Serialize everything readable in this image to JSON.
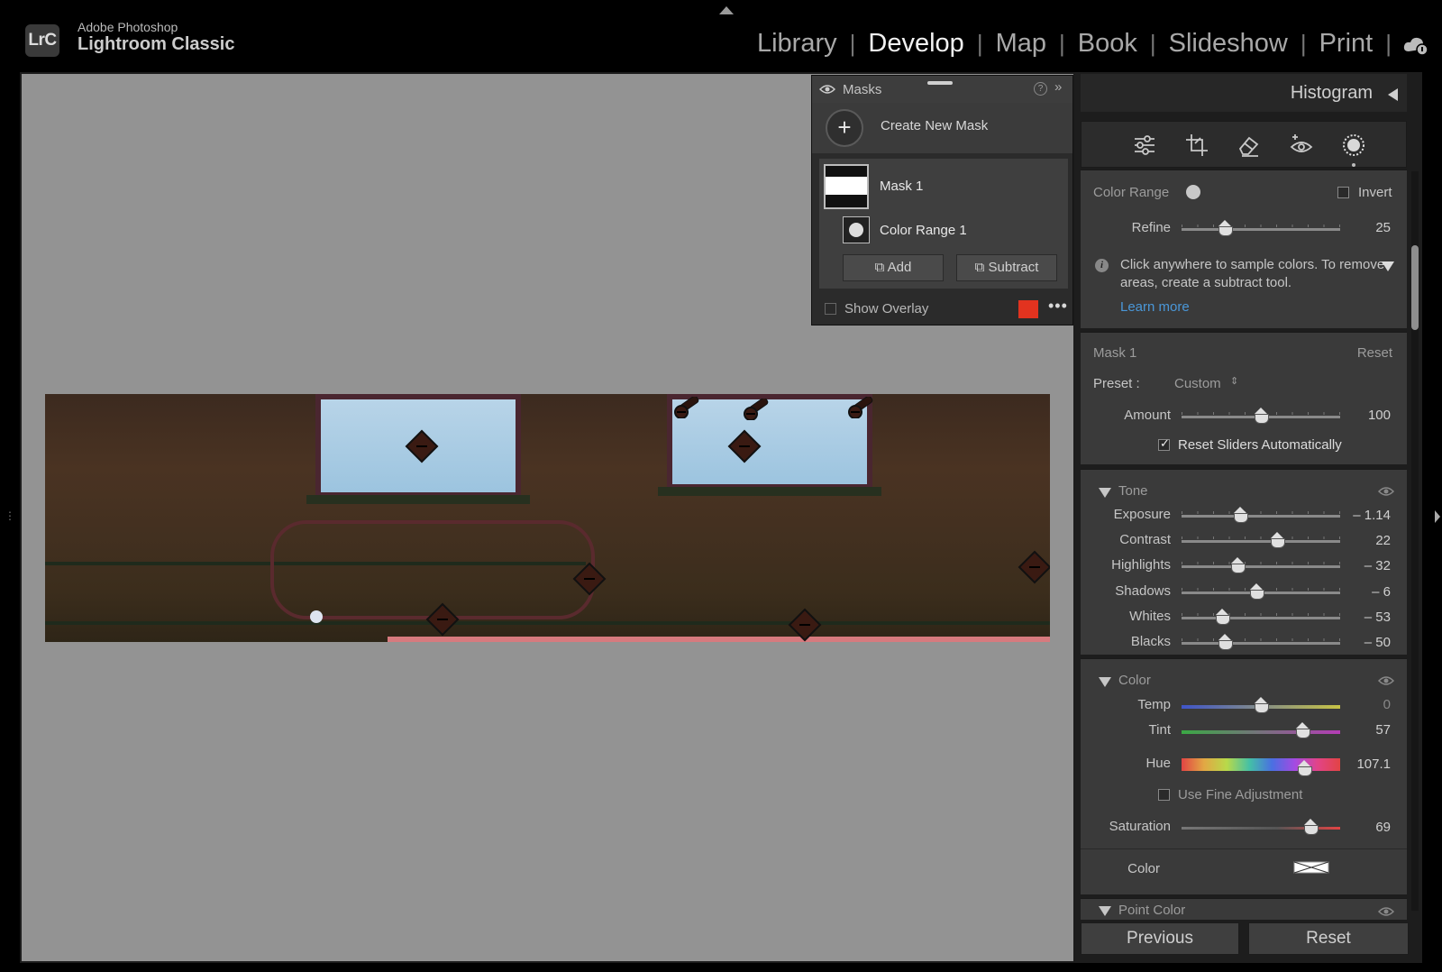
{
  "app": {
    "brand_line1": "Adobe Photoshop",
    "brand_line2": "Lightroom Classic",
    "logo": "LrC",
    "modules": [
      "Library",
      "Develop",
      "Map",
      "Book",
      "Slideshow",
      "Print"
    ],
    "active_module": "Develop",
    "cloud_icon": "cloud-sync-icon"
  },
  "masks_panel": {
    "title": "Masks",
    "help": "?",
    "create_label": "Create New Mask",
    "mask_name": "Mask 1",
    "component_name": "Color Range 1",
    "add_label": "Add",
    "subtract_label": "Subtract",
    "show_overlay_label": "Show Overlay",
    "show_overlay_checked": false,
    "overlay_color": "#e2331f",
    "more": "•••"
  },
  "right_panel": {
    "histogram_label": "Histogram",
    "tools": [
      "edit-sliders-icon",
      "crop-icon",
      "heal-eraser-icon",
      "redeye-icon",
      "masking-icon"
    ],
    "color_range": {
      "label": "Color Range",
      "invert_label": "Invert",
      "invert_checked": false,
      "refine_label": "Refine",
      "refine_value": "25",
      "refine_level": 0.27,
      "info_text_1": "Click anywhere to sample colors. To remove",
      "info_text_2": "areas, create a subtract tool.",
      "learn_more": "Learn more"
    },
    "mask_section": {
      "title": "Mask 1",
      "reset": "Reset",
      "preset_label": "Preset :",
      "preset_value": "Custom",
      "amount_label": "Amount",
      "amount_value": "100",
      "amount_level": 0.5,
      "reset_sliders_label": "Reset Sliders Automatically",
      "reset_sliders_checked": true
    },
    "tone": {
      "title": "Tone",
      "sliders": [
        {
          "label": "Exposure",
          "value": "– 1.14",
          "level": 0.37
        },
        {
          "label": "Contrast",
          "value": "22",
          "level": 0.605
        },
        {
          "label": "Highlights",
          "value": "– 32",
          "level": 0.355
        },
        {
          "label": "Shadows",
          "value": "– 6",
          "level": 0.47
        },
        {
          "label": "Whites",
          "value": "– 53",
          "level": 0.255
        },
        {
          "label": "Blacks",
          "value": "– 50",
          "level": 0.27
        }
      ]
    },
    "color": {
      "title": "Color",
      "temp_label": "Temp",
      "temp_value": "0",
      "temp_level": 0.5,
      "tint_label": "Tint",
      "tint_value": "57",
      "tint_level": 0.76,
      "hue_label": "Hue",
      "hue_value": "107.1",
      "hue_level": 0.77,
      "fine_adjust_label": "Use Fine Adjustment",
      "fine_adjust_checked": false,
      "saturation_label": "Saturation",
      "saturation_value": "69",
      "saturation_level": 0.815,
      "color_label": "Color"
    },
    "point_color": {
      "title": "Point Color"
    },
    "previous_label": "Previous",
    "reset_label": "Reset"
  }
}
